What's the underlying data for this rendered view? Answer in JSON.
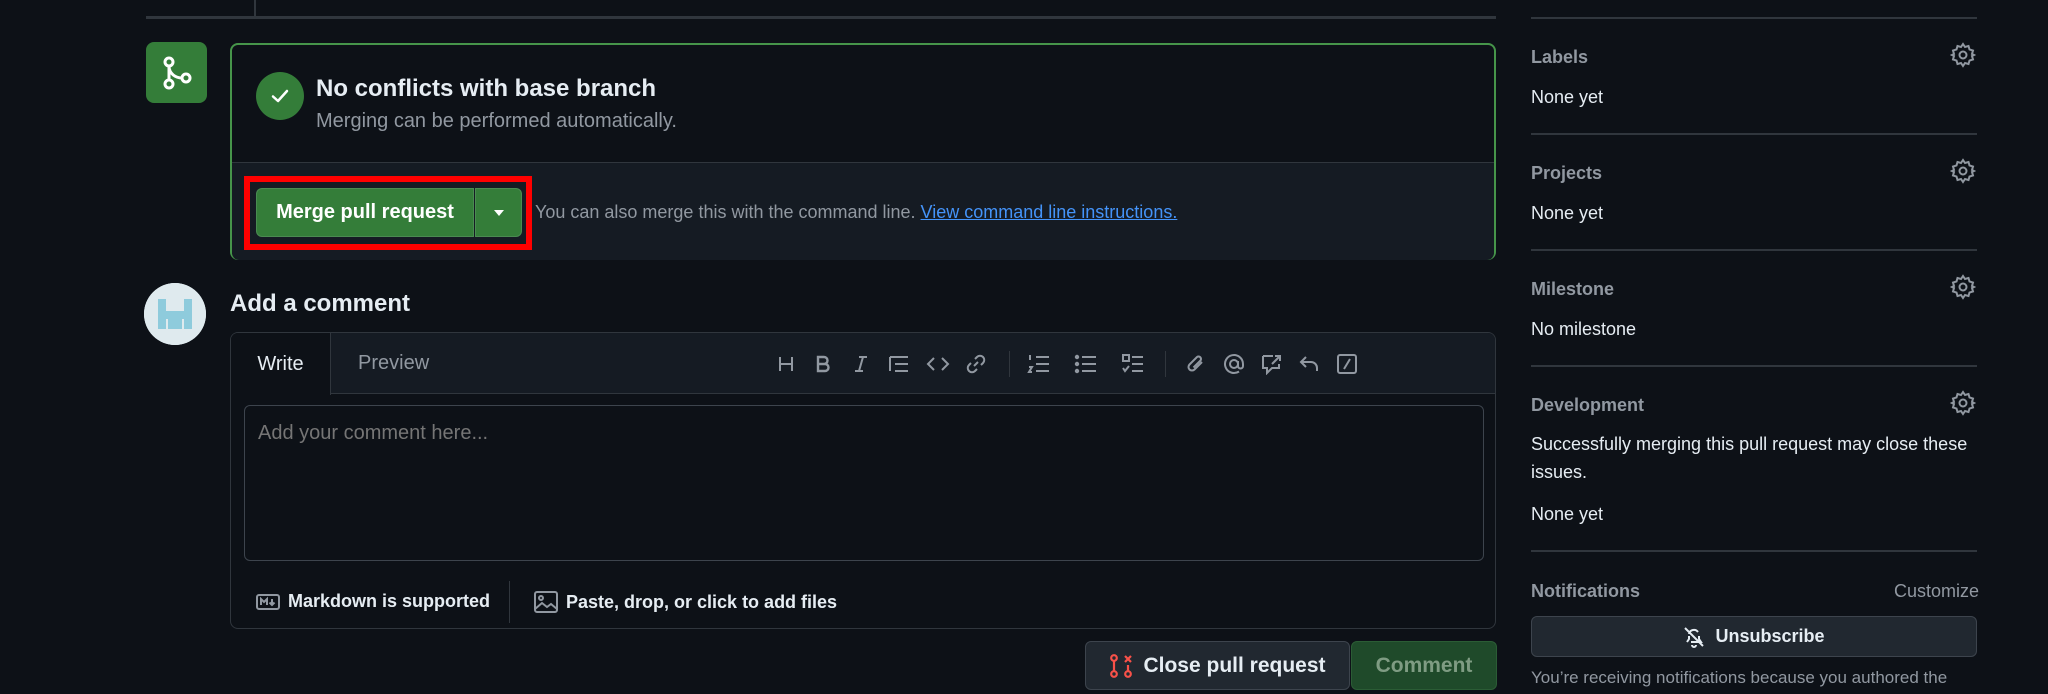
{
  "merge": {
    "title": "No conflicts with base branch",
    "subtitle": "Merging can be performed automatically.",
    "button_label": "Merge pull request",
    "help_text": "You can also merge this with the command line. ",
    "help_link": "View command line instructions."
  },
  "comment": {
    "heading": "Add a comment",
    "tab_write": "Write",
    "tab_preview": "Preview",
    "placeholder": "Add your comment here...",
    "markdown_note": "Markdown is supported",
    "attach_note": "Paste, drop, or click to add files",
    "close_button": "Close pull request",
    "comment_button": "Comment",
    "toolbar_icons": [
      "heading-icon",
      "bold-icon",
      "italic-icon",
      "quote-icon",
      "code-icon",
      "link-icon",
      "numbered-list-icon",
      "unordered-list-icon",
      "task-list-icon",
      "attach-icon",
      "mention-icon",
      "reference-icon",
      "undo-icon",
      "slash-command-icon"
    ]
  },
  "sidebar": {
    "labels": {
      "title": "Labels",
      "value": "None yet"
    },
    "projects": {
      "title": "Projects",
      "value": "None yet"
    },
    "milestone": {
      "title": "Milestone",
      "value": "No milestone"
    },
    "development": {
      "title": "Development",
      "description": "Successfully merging this pull request may close these issues.",
      "value": "None yet"
    },
    "notifications": {
      "title": "Notifications",
      "customize": "Customize",
      "unsubscribe": "Unsubscribe",
      "note": "You’re receiving notifications because you authored the"
    }
  },
  "colors": {
    "background": "#0d1117",
    "accent_green": "#347d39",
    "link_blue": "#4493f8",
    "highlight_red": "#ff0000",
    "close_icon_red": "#f85149"
  }
}
